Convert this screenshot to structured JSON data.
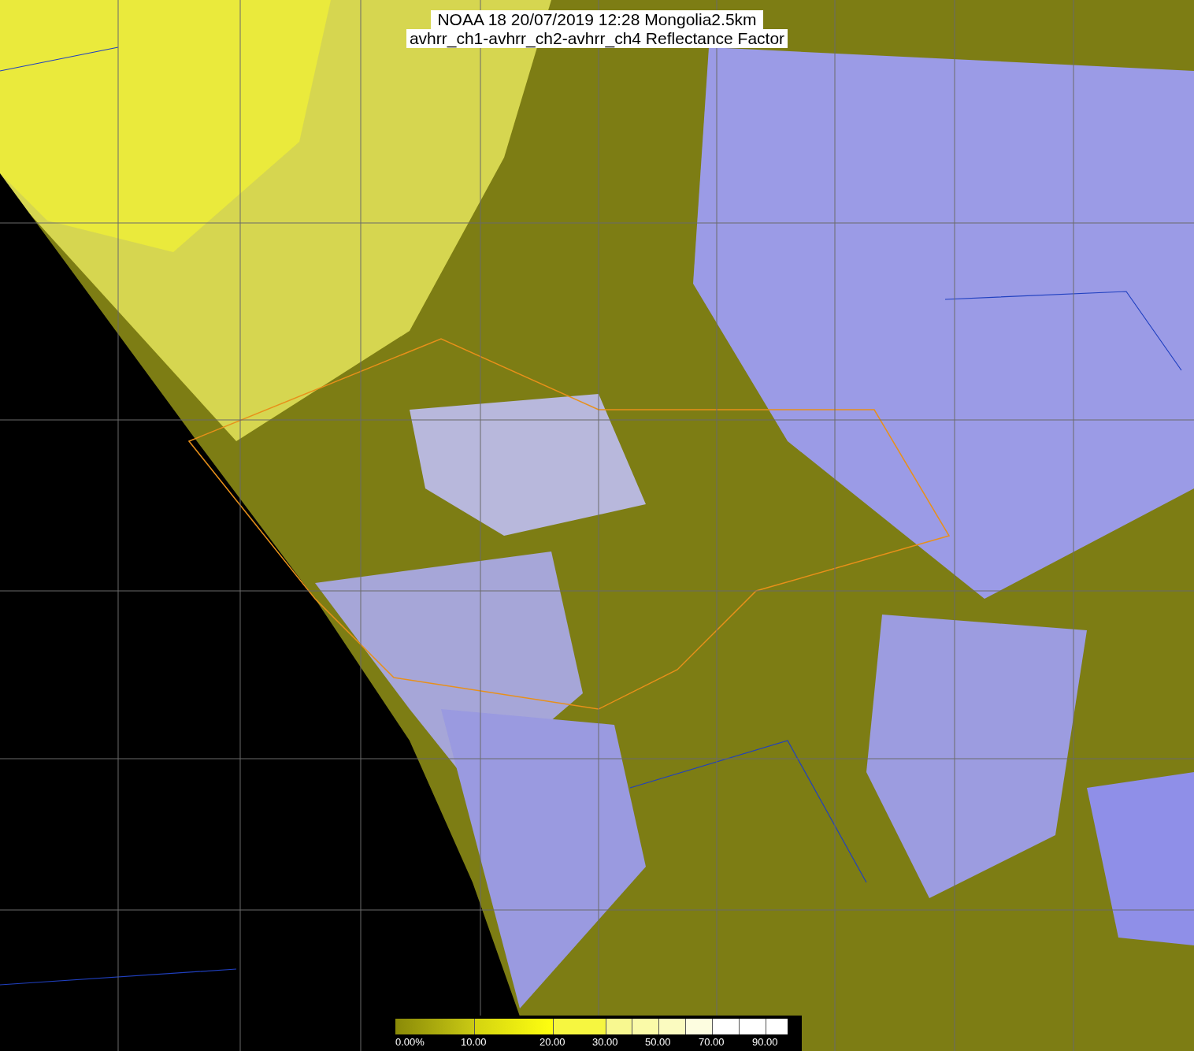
{
  "title": {
    "line_1": "NOAA 18 20/07/2019 12:28 Mongolia2.5km",
    "line_2": "avhrr_ch1-avhrr_ch2-avhrr_ch4 Reflectance Factor"
  },
  "colorbar": {
    "labels": [
      "0.00%",
      "10.00",
      "20.00",
      "30.00",
      "50.00",
      "70.00",
      "90.00"
    ]
  }
}
